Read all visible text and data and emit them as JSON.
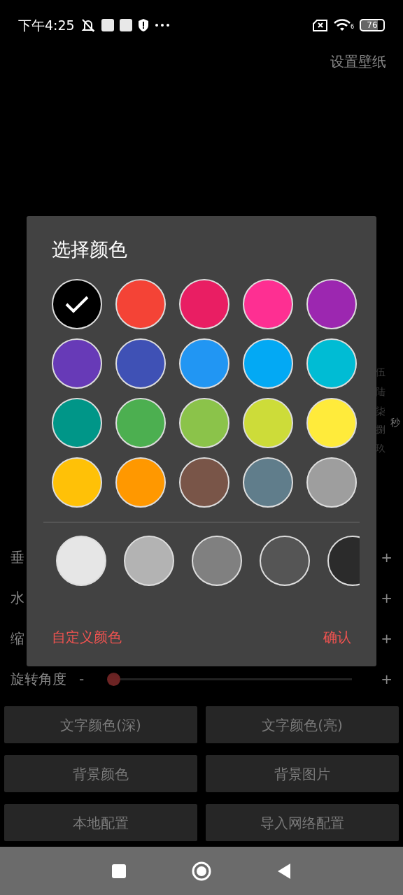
{
  "status_bar": {
    "time": "下午4:25",
    "wifi_badge": "6",
    "battery": "76"
  },
  "header": {
    "action": "设置壁纸"
  },
  "wallpaper_fragments": [
    {
      "text": "伍",
      "kind": "digit"
    },
    {
      "text": "陆",
      "kind": "digit"
    },
    {
      "text": "柒",
      "kind": "digit"
    },
    {
      "text": "捌",
      "kind": "digit"
    },
    {
      "text": "玖",
      "kind": "digit"
    },
    {
      "text": "秒",
      "kind": "unit"
    }
  ],
  "sliders": [
    {
      "label": "垂",
      "plus": "+"
    },
    {
      "label": "水",
      "plus": "+"
    },
    {
      "label": "缩",
      "plus": "+"
    },
    {
      "label": "旋转角度",
      "minus": "-",
      "level": 0,
      "plus": "+"
    }
  ],
  "buttons": [
    [
      "文字颜色(深)",
      "文字颜色(亮)"
    ],
    [
      "背景颜色",
      "背景图片"
    ],
    [
      "本地配置",
      "导入网络配置"
    ]
  ],
  "dialog": {
    "title": "选择颜色",
    "colors": [
      {
        "color": "#000000",
        "selected": true
      },
      {
        "color": "#f44336",
        "selected": false
      },
      {
        "color": "#e91e63",
        "selected": false
      },
      {
        "color": "#fe2f92",
        "selected": false
      },
      {
        "color": "#9c27b0",
        "selected": false
      },
      {
        "color": "#673ab7",
        "selected": false
      },
      {
        "color": "#3f51b5",
        "selected": false
      },
      {
        "color": "#2196f3",
        "selected": false
      },
      {
        "color": "#03a9f4",
        "selected": false
      },
      {
        "color": "#00bcd4",
        "selected": false
      },
      {
        "color": "#009688",
        "selected": false
      },
      {
        "color": "#4caf50",
        "selected": false
      },
      {
        "color": "#8bc34a",
        "selected": false
      },
      {
        "color": "#cddc39",
        "selected": false
      },
      {
        "color": "#ffeb3b",
        "selected": false
      },
      {
        "color": "#ffc107",
        "selected": false
      },
      {
        "color": "#ff9800",
        "selected": false
      },
      {
        "color": "#795548",
        "selected": false
      },
      {
        "color": "#607d8b",
        "selected": false
      },
      {
        "color": "#9e9e9e",
        "selected": false
      }
    ],
    "shades": [
      {
        "color": "#e6e6e6",
        "selected": false
      },
      {
        "color": "#b3b3b3",
        "selected": false
      },
      {
        "color": "#808080",
        "selected": false
      },
      {
        "color": "#555555",
        "selected": false
      },
      {
        "color": "#2b2b2b",
        "selected": false
      }
    ],
    "custom": "自定义颜色",
    "confirm": "确认"
  }
}
